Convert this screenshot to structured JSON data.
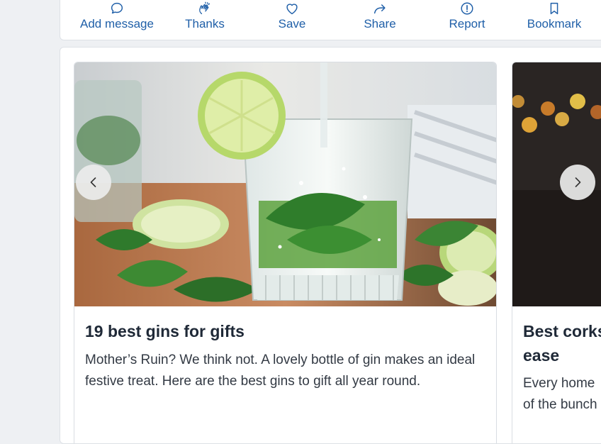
{
  "actions": [
    {
      "label": "Add message",
      "icon": "speech-bubble-icon"
    },
    {
      "label": "Thanks",
      "icon": "clapping-hands-icon"
    },
    {
      "label": "Save",
      "icon": "heart-icon"
    },
    {
      "label": "Share",
      "icon": "share-arrow-icon"
    },
    {
      "label": "Report",
      "icon": "exclamation-circle-icon"
    },
    {
      "label": "Bookmark",
      "icon": "bookmark-icon"
    }
  ],
  "colors": {
    "accent": "#1f5fa8",
    "background": "#eef0f3"
  },
  "cards": [
    {
      "title": "19 best gins for gifts",
      "description": "Mother’s Ruin? We think not. A lovely bottle of gin makes an ideal festive treat. Here are the best gins to gift all year round.",
      "image": "gin-and-tonic-with-lime-and-mint"
    },
    {
      "title": "Best corks ease",
      "title_line1": "Best corks",
      "title_line2": "ease",
      "desc_line1": "Every home",
      "desc_line2": "of the bunch",
      "image": "dark-bokeh-lights"
    }
  ],
  "carousel": {
    "prev_icon": "chevron-left-icon",
    "next_icon": "chevron-right-icon"
  }
}
